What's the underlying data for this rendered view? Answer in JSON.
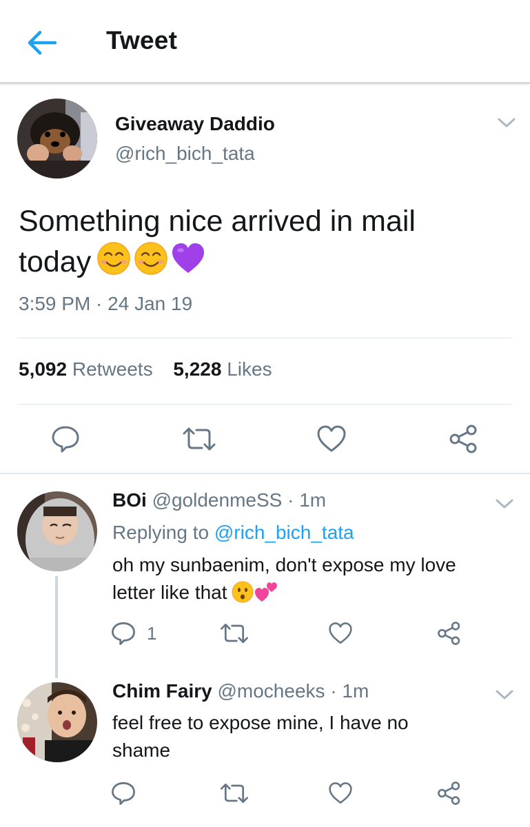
{
  "header": {
    "title": "Tweet",
    "back_icon": "arrow-left-icon",
    "accent": "#1da1f2"
  },
  "tweet": {
    "author_name": "Giveaway Daddio",
    "author_handle": "@rich_bich_tata",
    "text_line1": "Something nice arrived in mail",
    "text_line2": "today",
    "emojis": [
      "smiling-face-icon",
      "smiling-face-icon",
      "purple-heart-icon"
    ],
    "timestamp": "3:59 PM · 24 Jan 19",
    "retweets_count": "5,092",
    "retweets_label": "Retweets",
    "likes_count": "5,228",
    "likes_label": "Likes",
    "actions": [
      "reply-icon",
      "retweet-icon",
      "like-icon",
      "share-icon"
    ]
  },
  "replies": [
    {
      "name": "BOi",
      "handle": "@goldenmeSS",
      "time": "· 1m",
      "replying_to_label": "Replying to",
      "replying_to_handle": "@rich_bich_tata",
      "text_line1": "oh my sunbaenim, don't expose my love",
      "text_line2": "letter like that",
      "emojis": [
        "hushed-face-icon",
        "two-hearts-icon"
      ],
      "reply_count": "1"
    },
    {
      "name": "Chim Fairy",
      "handle": "@mocheeks",
      "time": "· 1m",
      "text_line1": "feel free to expose mine, I have no",
      "text_line2": "shame"
    }
  ],
  "colors": {
    "text": "#14171a",
    "secondary": "#657786",
    "link": "#1da1f2",
    "divider": "#e1e8ed",
    "purple_heart": "#a040e8",
    "pink_hearts": "#f0459a"
  }
}
